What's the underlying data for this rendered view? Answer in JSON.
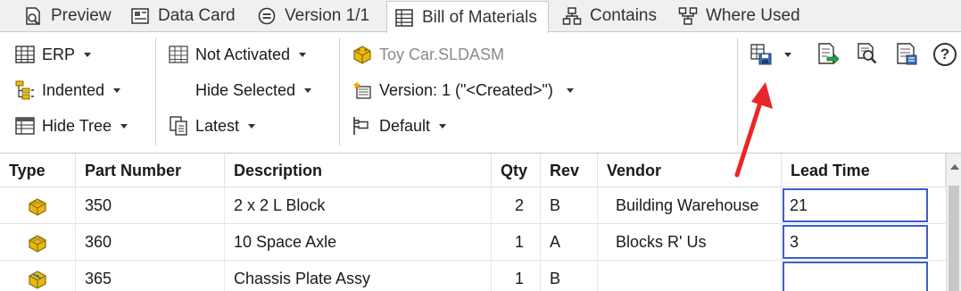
{
  "tabs": [
    {
      "label": "Preview",
      "icon": "preview-icon",
      "active": false
    },
    {
      "label": "Data Card",
      "icon": "data-card-icon",
      "active": false
    },
    {
      "label": "Version 1/1",
      "icon": "version-icon",
      "active": false
    },
    {
      "label": "Bill of Materials",
      "icon": "bill-of-materials-icon",
      "active": true
    },
    {
      "label": "Contains",
      "icon": "contains-icon",
      "active": false
    },
    {
      "label": "Where Used",
      "icon": "where-used-icon",
      "active": false
    }
  ],
  "toolbar": {
    "erp": "ERP",
    "indented": "Indented",
    "hide_tree": "Hide Tree",
    "not_activated": "Not Activated",
    "hide_selected": "Hide Selected",
    "latest": "Latest",
    "file_name": "Toy Car.SLDASM",
    "version": "Version: 1 (\"<Created>\")",
    "configuration": "Default",
    "right_icons": [
      "save-bom-icon",
      "export-icon",
      "find-icon",
      "properties-icon",
      "help-icon"
    ],
    "help_symbol": "?"
  },
  "grid": {
    "columns": [
      "Type",
      "Part Number",
      "Description",
      "Qty",
      "Rev",
      "Vendor",
      "Lead Time"
    ],
    "rows": [
      {
        "type_icon": "part-icon",
        "part_number": "350",
        "description": "2 x 2 L Block",
        "qty": "2",
        "rev": "B",
        "vendor": "Building Warehouse",
        "lead_time": "21"
      },
      {
        "type_icon": "part-icon",
        "part_number": "360",
        "description": "10 Space Axle",
        "qty": "1",
        "rev": "A",
        "vendor": "Blocks R' Us",
        "lead_time": "3"
      },
      {
        "type_icon": "assembly-icon",
        "part_number": "365",
        "description": "Chassis Plate Assy",
        "qty": "1",
        "rev": "B",
        "vendor": "",
        "lead_time": ""
      }
    ]
  },
  "colors": {
    "arrow": "#e8262a",
    "edit_border": "#3b5fc8",
    "part_icon": "#e8b90f"
  }
}
